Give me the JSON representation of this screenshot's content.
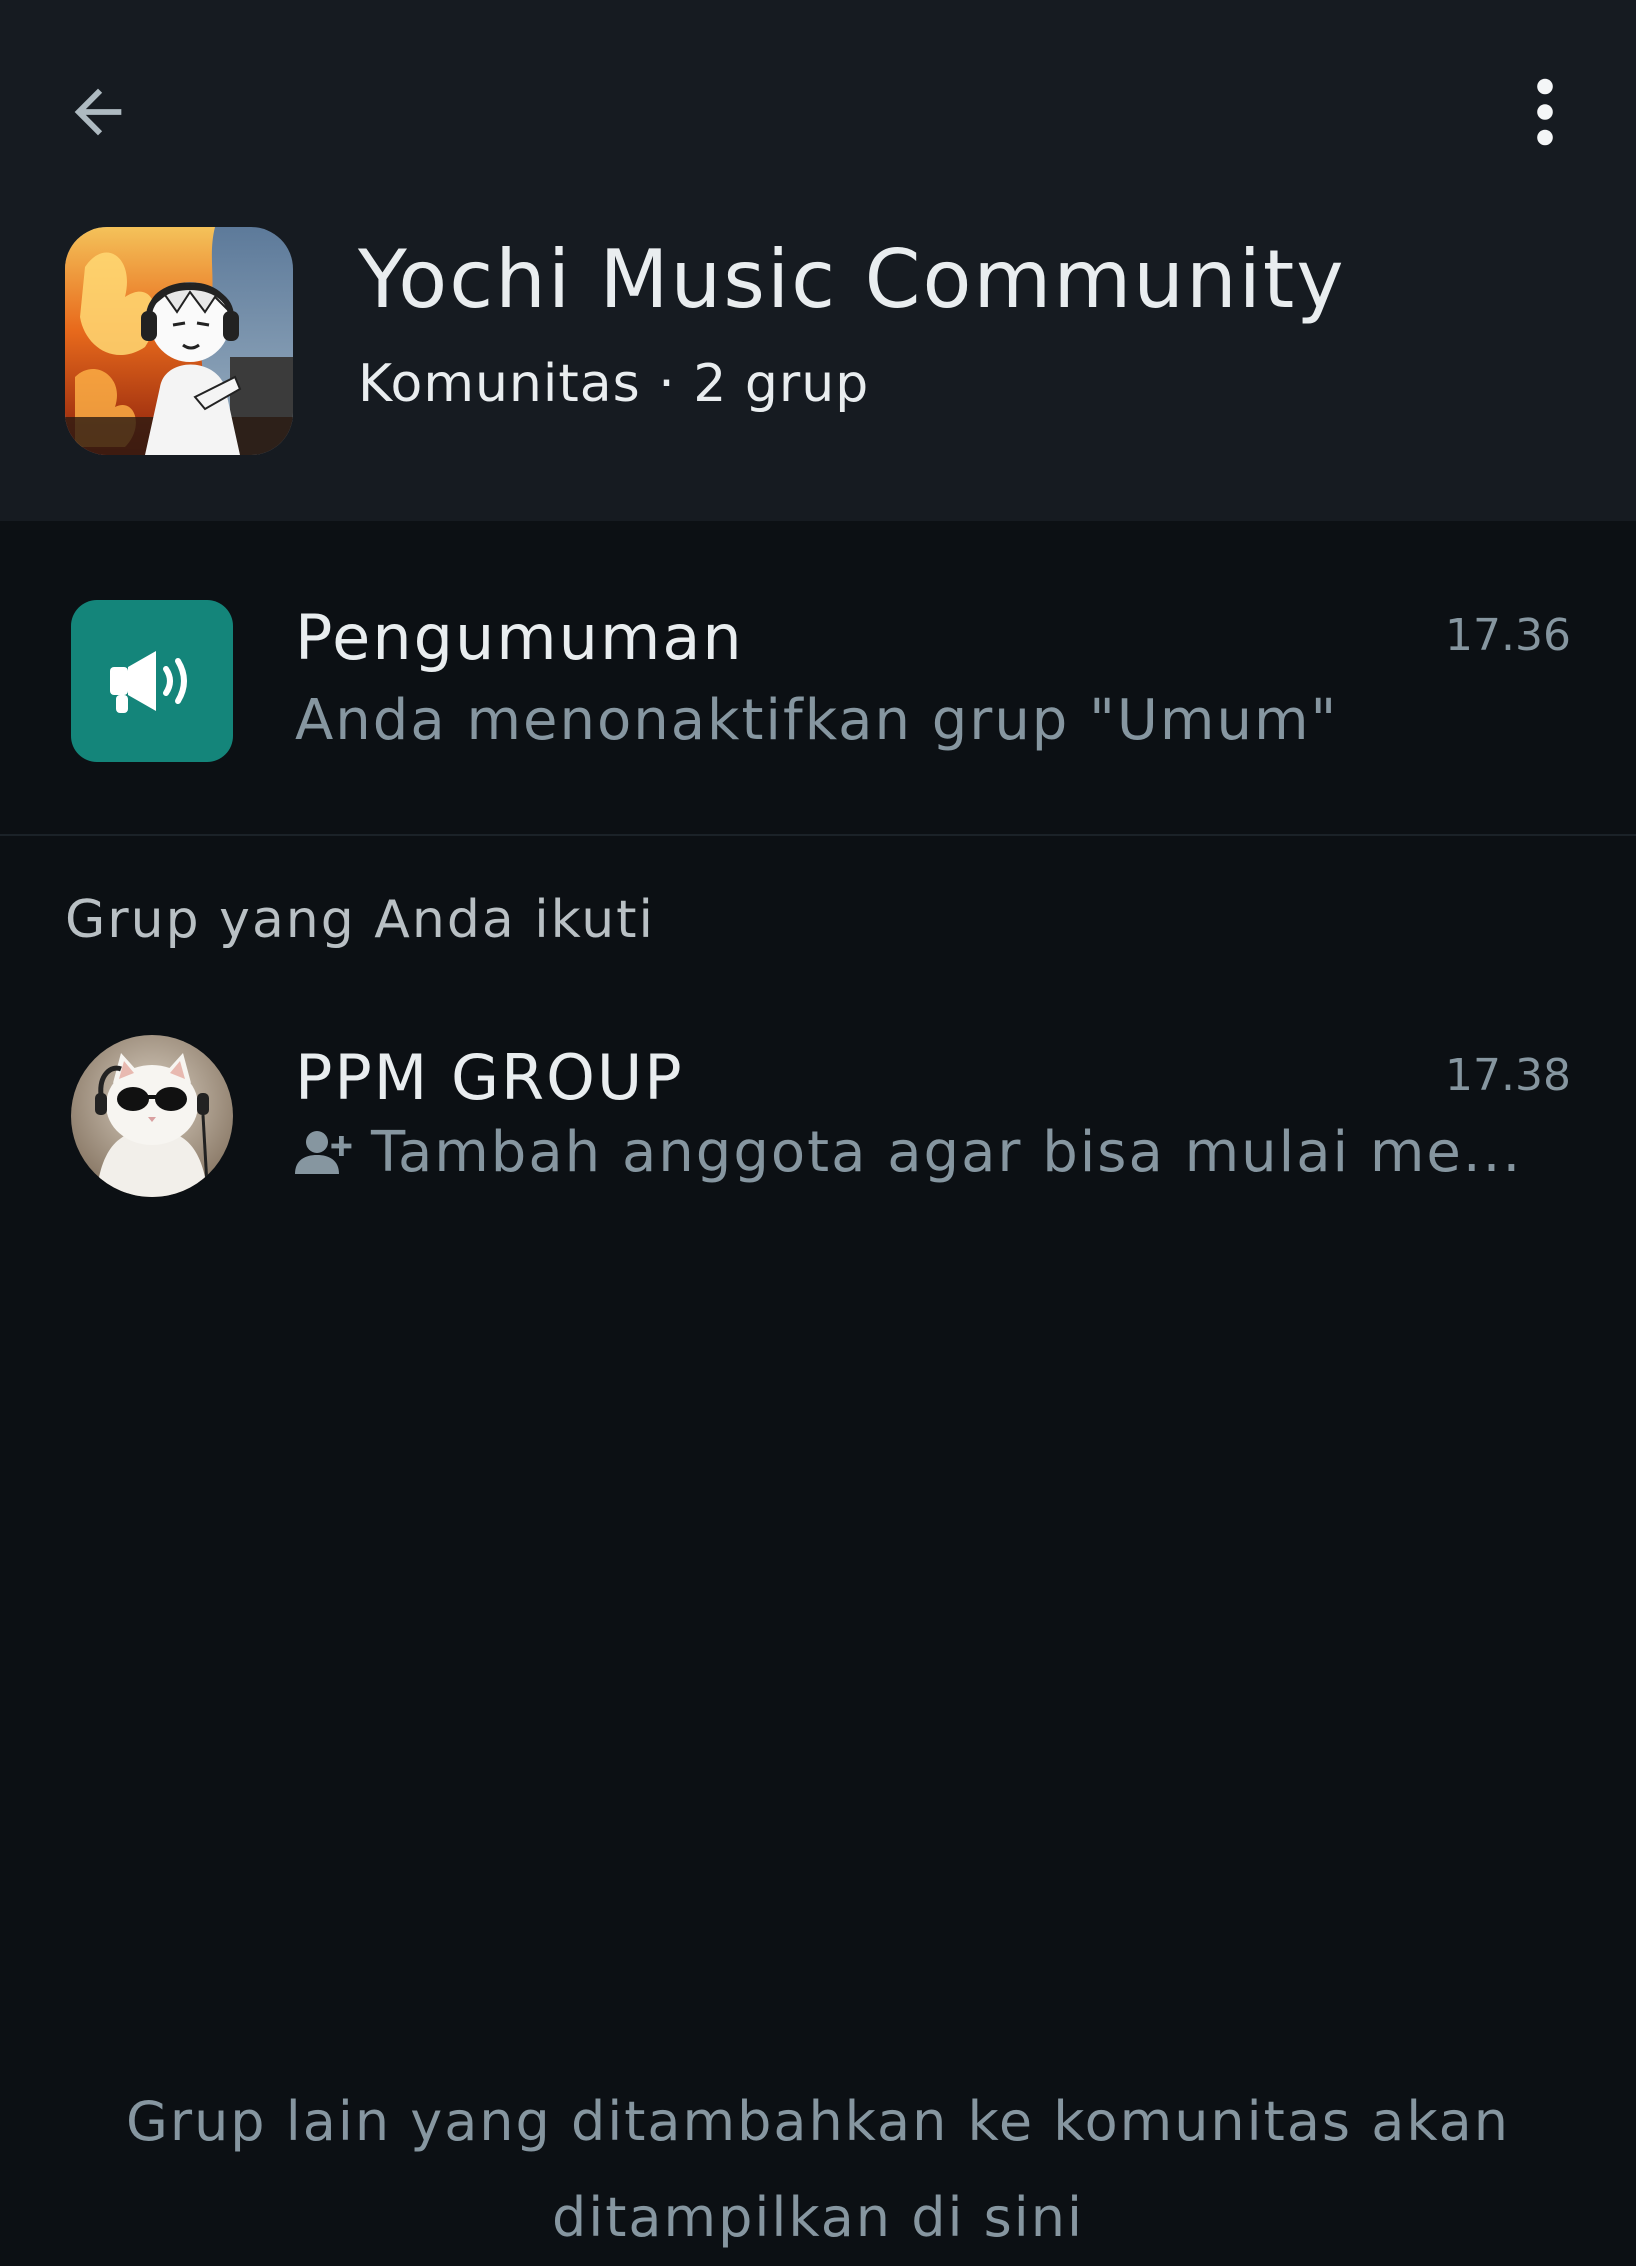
{
  "header": {
    "back_icon": "arrow-left-icon",
    "menu_icon": "more-vertical-icon",
    "community_name": "Yochi Music Community",
    "community_meta": "Komunitas · 2 grup"
  },
  "announcement": {
    "title": "Pengumuman",
    "time": "17.36",
    "subtitle": "Anda menonaktifkan grup \"Umum\"",
    "icon": "megaphone-icon",
    "icon_bg": "#14857a"
  },
  "groups_section": {
    "label": "Grup yang Anda ikuti",
    "items": [
      {
        "title": "PPM GROUP",
        "time": "17.38",
        "subtitle": "Tambah anggota agar bisa mulai me...",
        "subtitle_icon": "add-person-icon"
      }
    ]
  },
  "footer": {
    "note_line1": "Grup lain yang ditambahkan ke komunitas akan",
    "note_line2": "ditampilkan di sini"
  },
  "colors": {
    "background": "#0c1014",
    "header_bg": "#161b21",
    "primary_text": "#e9edef",
    "secondary_text": "#8696a0",
    "accent": "#14857a"
  }
}
